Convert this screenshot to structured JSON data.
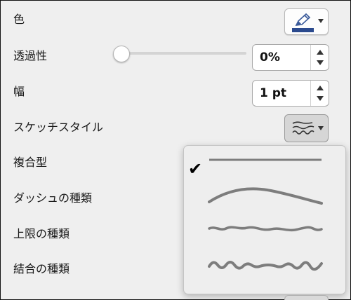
{
  "panel": {
    "rows": [
      {
        "label": "色"
      },
      {
        "label": "透過性"
      },
      {
        "label": "幅"
      },
      {
        "label": "スケッチスタイル"
      },
      {
        "label": "複合型"
      },
      {
        "label": "ダッシュの種類"
      },
      {
        "label": "上限の種類"
      },
      {
        "label": "結合の種類"
      }
    ],
    "color": {
      "icon": "pen-icon",
      "swatch_color": "#2b4a8e"
    },
    "transparency": {
      "slider_value_fraction": 0,
      "value": "0%"
    },
    "width": {
      "value": "1 pt"
    },
    "sketch_style": {
      "icon": "sketch-line-icon",
      "options": [
        {
          "id": "straight",
          "selected": true,
          "icon": "straight-line-icon"
        },
        {
          "id": "curved",
          "selected": false,
          "icon": "curved-line-icon"
        },
        {
          "id": "freehand",
          "selected": false,
          "icon": "freehand-line-icon"
        },
        {
          "id": "scribble",
          "selected": false,
          "icon": "scribble-line-icon"
        }
      ],
      "check_mark": "✔"
    }
  }
}
